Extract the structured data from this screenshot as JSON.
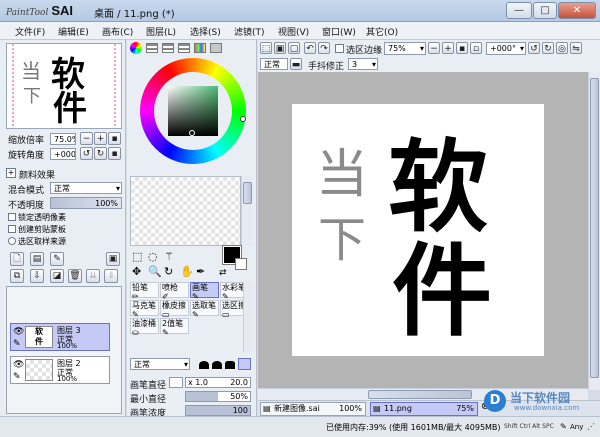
{
  "app": {
    "logo_small": "PaintTool",
    "logo_big": "SAI",
    "title": "桌面 / 11.png (*)"
  },
  "window_buttons": {
    "minimize": "—",
    "maximize": "□",
    "close": "✕"
  },
  "menu": [
    "文件(F)",
    "编辑(E)",
    "画布(C)",
    "图层(L)",
    "选择(S)",
    "滤镜(T)",
    "视图(V)",
    "窗口(W)",
    "其它(O)"
  ],
  "navigator": {
    "zoom_label": "缩放倍率",
    "zoom_value": "75.0%",
    "angle_label": "旋转角度",
    "angle_value": "+000°"
  },
  "effects": {
    "header": "颜料效果",
    "blend_label": "混合模式",
    "blend_value": "正常",
    "opacity_label": "不透明度",
    "opacity_value": "100%",
    "options": [
      "锁定透明像素",
      "创建剪贴蒙板",
      "选区取样来源"
    ]
  },
  "layers": [
    {
      "name": "图层 3",
      "mode": "正常",
      "opacity": "100%",
      "selected": true
    },
    {
      "name": "图层 2",
      "mode": "正常",
      "opacity": "100%",
      "selected": false
    }
  ],
  "brush": {
    "tools": [
      {
        "label": "铅笔",
        "selected": false
      },
      {
        "label": "喷枪",
        "selected": false
      },
      {
        "label": "画笔",
        "selected": true
      },
      {
        "label": "水彩笔",
        "selected": false
      },
      {
        "label": "马克笔",
        "selected": false
      },
      {
        "label": "橡皮擦",
        "selected": false
      },
      {
        "label": "选取笔",
        "selected": false
      },
      {
        "label": "选区擦",
        "selected": false
      },
      {
        "label": "油漆桶",
        "selected": false
      },
      {
        "label": "2值笔",
        "selected": false
      }
    ],
    "mode_value": "正常",
    "size_label": "画笔直径",
    "size_multiplier": "x 1.0",
    "size_value": "20.0",
    "min_label": "最小直径",
    "min_value": "50%",
    "density_label": "画笔浓度",
    "density_value": "100"
  },
  "canvas_toolbar": {
    "selection_edge_label": "选区边缘",
    "zoom_value": "75%",
    "rotation_value": "+000°",
    "mode_value": "正常",
    "stabilizer_label": "手抖修正",
    "stabilizer_value": "3"
  },
  "canvas_art": {
    "big_text_1": "软",
    "big_text_2": "件",
    "small_text_1": "当",
    "small_text_2": "下"
  },
  "doc_tabs": [
    {
      "name": "新建图像.sai",
      "zoom": "100%",
      "active": false
    },
    {
      "name": "11.png",
      "zoom": "75%",
      "active": true
    }
  ],
  "status": {
    "memory": "已使用内存:39% (使用 1601MB/最大 4095MB)",
    "keys": "Shift Ctrl Alt SPC",
    "any": "Any"
  },
  "watermark": {
    "brand": "当下软件园",
    "url": "www.downxia.com"
  },
  "colors": {
    "selected_layer_bg": "#c5c9f6",
    "hue_sv_square": "#4fba73",
    "primary_color": "#000000"
  }
}
